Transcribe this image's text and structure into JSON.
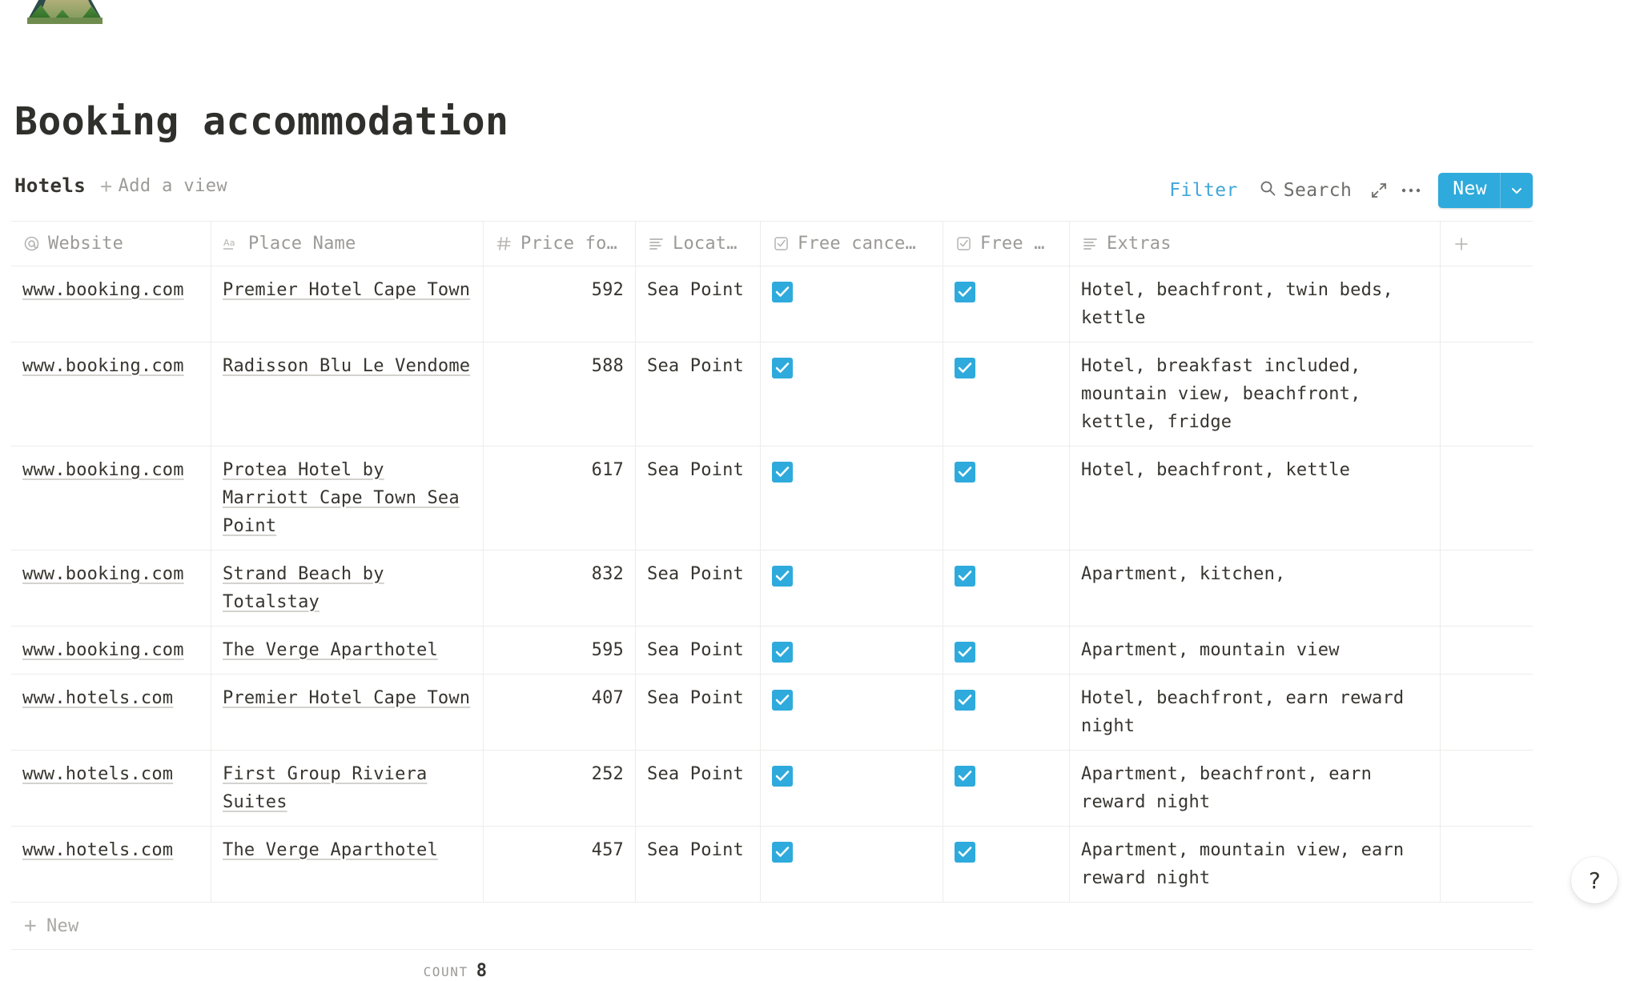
{
  "page": {
    "icon_name": "mountain-image-icon",
    "title": "Booking accommodation"
  },
  "viewbar": {
    "active_view": "Hotels",
    "add_view_label": "Add a view",
    "filter_label": "Filter",
    "search_label": "Search",
    "expand_icon": "expand-diagonal-icon",
    "more_icon": "ellipsis-icon",
    "new_label": "New",
    "new_caret_icon": "chevron-down-icon",
    "accent_color": "#2eaadc",
    "filter_color": "#41a7d8"
  },
  "table": {
    "columns": [
      {
        "label": "Website",
        "icon": "link-at-icon",
        "type": "url"
      },
      {
        "label": "Place Name",
        "icon": "text-aa-icon",
        "type": "title"
      },
      {
        "label": "Price fo…",
        "icon": "number-hash-icon",
        "type": "number"
      },
      {
        "label": "Locat…",
        "icon": "text-lines-icon",
        "type": "text"
      },
      {
        "label": "Free cance…",
        "icon": "checkbox-icon",
        "type": "checkbox"
      },
      {
        "label": "Free …",
        "icon": "checkbox-icon",
        "type": "checkbox"
      },
      {
        "label": "Extras",
        "icon": "text-lines-icon",
        "type": "text"
      },
      {
        "label": "",
        "icon": "plus-icon",
        "type": "add-column"
      }
    ],
    "rows": [
      {
        "website": "www.booking.com",
        "place_name": "Premier Hotel Cape Town",
        "price": "592",
        "location": "Sea Point",
        "free_cancellation": true,
        "free_extra": true,
        "extras": "Hotel, beachfront, twin beds, kettle"
      },
      {
        "website": "www.booking.com",
        "place_name": "Radisson Blu Le Vendome",
        "price": "588",
        "location": "Sea Point",
        "free_cancellation": true,
        "free_extra": true,
        "extras": "Hotel, breakfast included, mountain view, beachfront, kettle, fridge"
      },
      {
        "website": "www.booking.com",
        "place_name": "Protea Hotel by Marriott Cape Town Sea Point",
        "price": "617",
        "location": "Sea Point",
        "free_cancellation": true,
        "free_extra": true,
        "extras": "Hotel, beachfront, kettle"
      },
      {
        "website": "www.booking.com",
        "place_name": "Strand Beach by Totalstay",
        "price": "832",
        "location": "Sea Point",
        "free_cancellation": true,
        "free_extra": true,
        "extras": "Apartment, kitchen,"
      },
      {
        "website": "www.booking.com",
        "place_name": "The Verge Aparthotel",
        "price": "595",
        "location": "Sea Point",
        "free_cancellation": true,
        "free_extra": true,
        "extras": "Apartment, mountain view"
      },
      {
        "website": "www.hotels.com",
        "place_name": "Premier Hotel Cape Town",
        "price": "407",
        "location": "Sea Point",
        "free_cancellation": true,
        "free_extra": true,
        "extras": "Hotel, beachfront, earn reward night"
      },
      {
        "website": "www.hotels.com",
        "place_name": "First Group Riviera Suites",
        "price": "252",
        "location": "Sea Point",
        "free_cancellation": true,
        "free_extra": true,
        "extras": "Apartment, beachfront, earn reward night"
      },
      {
        "website": "www.hotels.com",
        "place_name": "The Verge Aparthotel",
        "price": "457",
        "location": "Sea Point",
        "free_cancellation": true,
        "free_extra": true,
        "extras": "Apartment, mountain view, earn reward night"
      }
    ],
    "new_row_label": "New",
    "count_label": "COUNT",
    "count_value": "8"
  },
  "help": {
    "label": "?"
  }
}
